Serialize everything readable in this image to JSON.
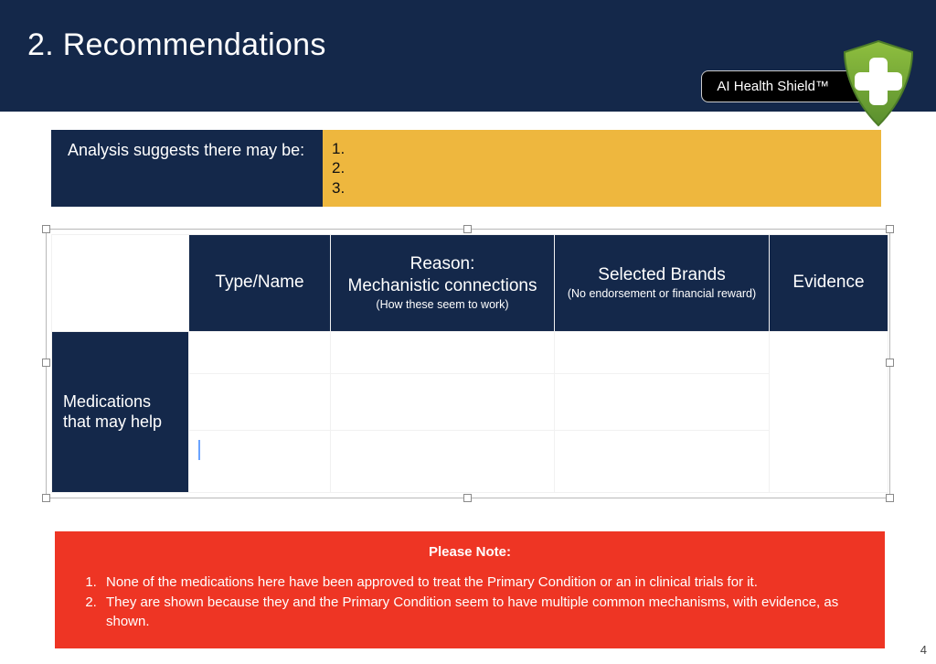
{
  "header": {
    "title": "2. Recommendations",
    "brand": "AI Health Shield™"
  },
  "analysis": {
    "label": "Analysis suggests there may be:",
    "items": [
      "1.",
      "2.",
      "3."
    ]
  },
  "table": {
    "columns": {
      "type_name": "Type/Name",
      "reason_main": "Reason:",
      "reason_sub1": "Mechanistic connections",
      "reason_sub2": "(How these seem to work)",
      "brands_main": "Selected Brands",
      "brands_sub": "(No endorsement or financial reward)",
      "evidence": "Evidence"
    },
    "row_header": "Medications that may help"
  },
  "note": {
    "title": "Please Note:",
    "items": [
      "None of the medications here have been approved to treat the Primary Condition or an in clinical trials for it.",
      "They are shown because they and the Primary Condition seem to have multiple common mechanisms, with evidence, as shown."
    ]
  },
  "page_number": "4",
  "colors": {
    "header_bg": "#14284a",
    "accent_yellow": "#eeb73e",
    "note_red": "#ee3524"
  }
}
